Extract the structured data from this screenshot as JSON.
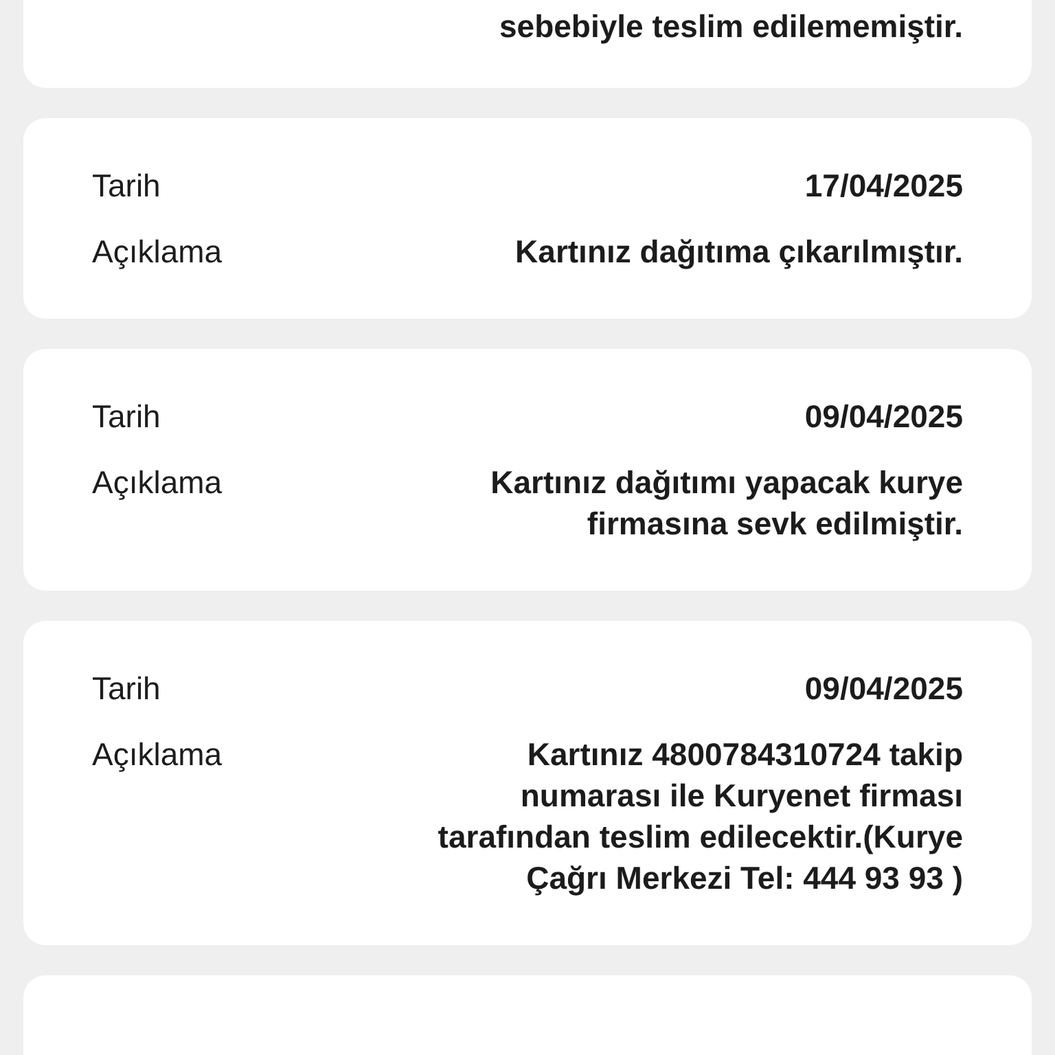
{
  "entries": [
    {
      "description": "sebebiyle teslim edilememiştir."
    },
    {
      "date_label": "Tarih",
      "date": "17/04/2025",
      "description_label": "Açıklama",
      "description": "Kartınız dağıtıma çıkarılmıştır."
    },
    {
      "date_label": "Tarih",
      "date": "09/04/2025",
      "description_label": "Açıklama",
      "description": "Kartınız dağıtımı yapacak kurye\nfirmasına sevk edilmiştir."
    },
    {
      "date_label": "Tarih",
      "date": "09/04/2025",
      "description_label": "Açıklama",
      "description": "Kartınız 4800784310724 takip\nnumarası ile Kuryenet firması\ntarafından teslim edilecektir.(Kurye\nÇağrı Merkezi Tel: 444 93 93 )"
    }
  ]
}
